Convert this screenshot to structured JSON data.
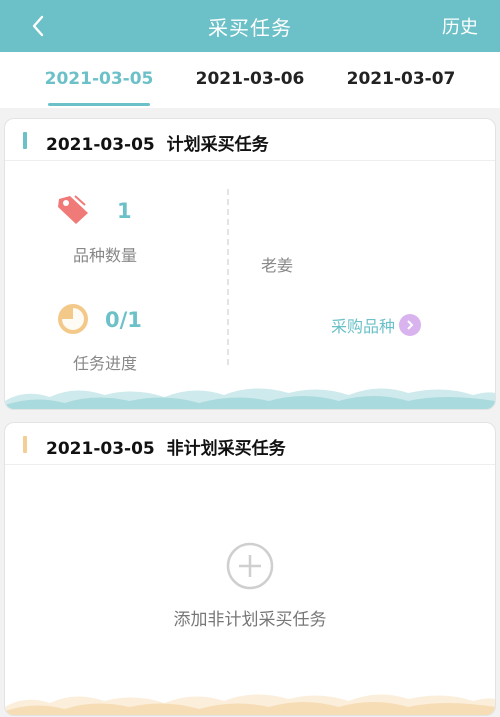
{
  "header": {
    "title": "采买任务",
    "history_label": "历史",
    "back_icon": "chevron-left-icon"
  },
  "tabs": [
    {
      "label": "2021-03-05",
      "active": true
    },
    {
      "label": "2021-03-06",
      "active": false
    },
    {
      "label": "2021-03-07",
      "active": false
    }
  ],
  "planned_card": {
    "date": "2021-03-05",
    "title": "计划采买任务",
    "marker_color": "#6cc1c8",
    "variety_count": "1",
    "variety_count_label": "品种数量",
    "progress_value": "0/1",
    "progress_label": "任务进度",
    "progress_fraction": 0,
    "variety_item": "老姜",
    "purchase_link_label": "采购品种"
  },
  "unplanned_card": {
    "date": "2021-03-05",
    "title": "非计划采买任务",
    "marker_color": "#f3cf95",
    "add_label": "添加非计划采买任务"
  },
  "colors": {
    "accent": "#6cc1c8",
    "tag_icon": "#f07a78",
    "progress_icon": "#f3c98a",
    "link_arrow_bg": "#d9b3ee"
  }
}
